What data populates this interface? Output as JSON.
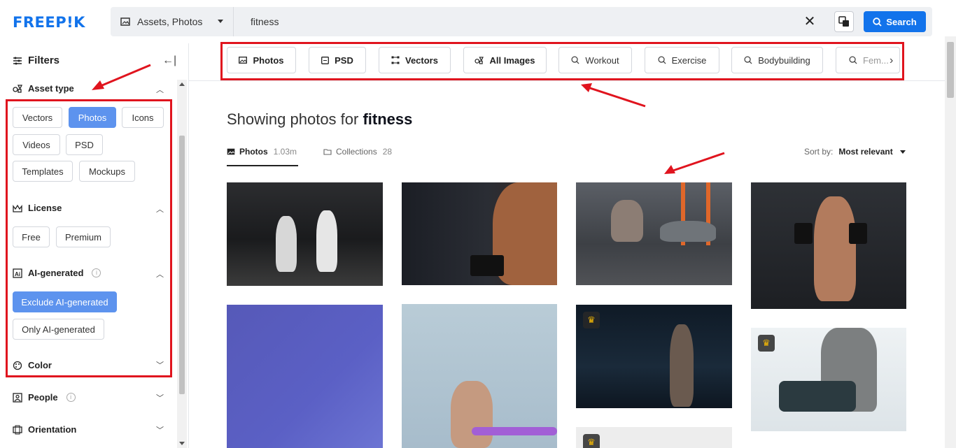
{
  "brand": {
    "logo": "FREEP!K",
    "accent": "#1273eb"
  },
  "search": {
    "type_label": "Assets, Photos",
    "value": "fitness",
    "button_label": "Search"
  },
  "sidebar": {
    "title": "Filters",
    "sections": {
      "asset_type": {
        "title": "Asset type",
        "options": [
          "Vectors",
          "Photos",
          "Icons",
          "Videos",
          "PSD",
          "Templates",
          "Mockups"
        ],
        "selected": "Photos"
      },
      "license": {
        "title": "License",
        "options": [
          "Free",
          "Premium"
        ]
      },
      "ai_generated": {
        "title": "AI-generated",
        "options": [
          "Exclude AI-generated",
          "Only AI-generated"
        ],
        "selected": "Exclude AI-generated"
      },
      "color": {
        "title": "Color"
      },
      "people": {
        "title": "People"
      },
      "orientation": {
        "title": "Orientation"
      }
    }
  },
  "categories": [
    "Photos",
    "PSD",
    "Vectors",
    "All Images",
    "Workout",
    "Exercise",
    "Bodybuilding",
    "Fem..."
  ],
  "main": {
    "title_prefix": "Showing photos for",
    "title_query": "fitness",
    "tabs": [
      {
        "label": "Photos",
        "count": "1.03m"
      },
      {
        "label": "Collections",
        "count": "28"
      }
    ],
    "sort_label": "Sort by:",
    "sort_value": "Most relevant"
  },
  "thumbnails": [
    {
      "name": "gym-lunges-photo",
      "premium": false
    },
    {
      "name": "muscular-dumbbell-photo",
      "premium": false
    },
    {
      "name": "plank-rows-photo",
      "premium": false
    },
    {
      "name": "bicep-curl-gym-photo",
      "premium": false
    },
    {
      "name": "purple-gradient-photo",
      "premium": false
    },
    {
      "name": "resistance-band-photo",
      "premium": false
    },
    {
      "name": "woman-gym-premium-photo",
      "premium": true
    },
    {
      "name": "dumbbell-closeup-premium-photo",
      "premium": true
    },
    {
      "name": "premium-placeholder-photo",
      "premium": true
    }
  ],
  "annotation_color": "#e0141e"
}
